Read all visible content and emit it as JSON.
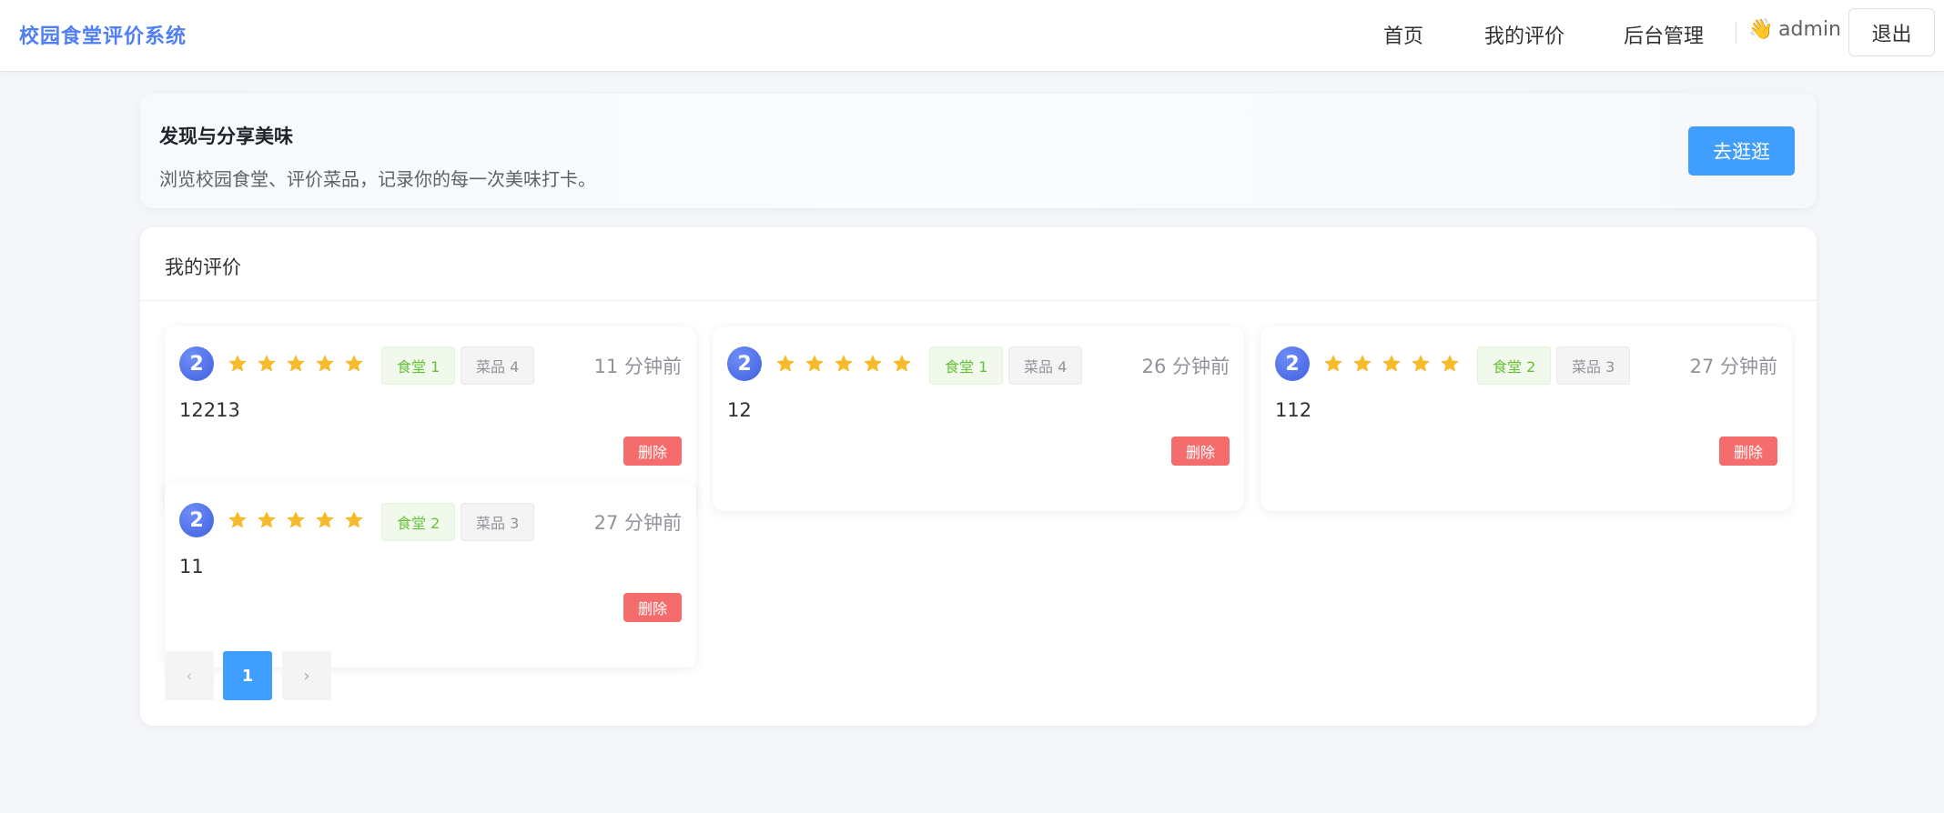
{
  "header": {
    "brand": "校园食堂评价系统",
    "nav": {
      "home": "首页",
      "my_reviews": "我的评价",
      "admin": "后台管理"
    },
    "user_wave": "👋",
    "username": "admin",
    "logout_label": "退出"
  },
  "hero": {
    "title": "发现与分享美味",
    "subtitle": "浏览校园食堂、评价菜品，记录你的每一次美味打卡。",
    "button_label": "去逛逛"
  },
  "reviews_panel": {
    "title": "我的评价",
    "delete_label": "删除",
    "items": [
      {
        "avatar": "2",
        "rating": 5,
        "canteen": "食堂 1",
        "dish": "菜品 4",
        "time": "11 分钟前",
        "content": "12213"
      },
      {
        "avatar": "2",
        "rating": 5,
        "canteen": "食堂 1",
        "dish": "菜品 4",
        "time": "26 分钟前",
        "content": "12"
      },
      {
        "avatar": "2",
        "rating": 5,
        "canteen": "食堂 2",
        "dish": "菜品 3",
        "time": "27 分钟前",
        "content": "112"
      },
      {
        "avatar": "2",
        "rating": 5,
        "canteen": "食堂 2",
        "dish": "菜品 3",
        "time": "27 分钟前",
        "content": "11"
      }
    ]
  },
  "pagination": {
    "prev_icon": "‹",
    "current_page": "1",
    "next_icon": "›"
  },
  "colors": {
    "brand": "#4f7ef5",
    "primary": "#409eff",
    "danger": "#f56c6c",
    "star": "#f7ba2a"
  }
}
